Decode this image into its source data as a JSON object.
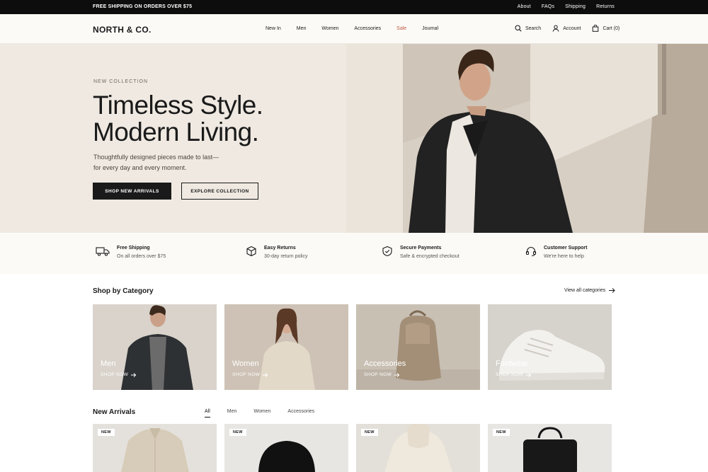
{
  "topbar": {
    "promo": "FREE SHIPPING ON ORDERS OVER $75",
    "links": [
      "About",
      "FAQs",
      "Shipping",
      "Returns"
    ]
  },
  "nav": {
    "logo": "NORTH & CO.",
    "menu": [
      "New In",
      "Men",
      "Women",
      "Accessories",
      "Sale",
      "Journal"
    ],
    "search": "Search",
    "account": "Account",
    "cart": "Cart (0)"
  },
  "hero": {
    "eyebrow": "NEW COLLECTION",
    "headline_1": "Timeless Style.",
    "headline_2": "Modern Living.",
    "sub_1": "Thoughtfully designed pieces made to last—",
    "sub_2": "for every day and every moment.",
    "cta_primary": "SHOP NEW ARRIVALS",
    "cta_secondary": "EXPLORE COLLECTION"
  },
  "features": [
    {
      "title": "Free Shipping",
      "sub": "On all orders over $75",
      "icon": "truck-icon"
    },
    {
      "title": "Easy Returns",
      "sub": "30-day return policy",
      "icon": "box-icon"
    },
    {
      "title": "Secure Payments",
      "sub": "Safe & encrypted checkout",
      "icon": "shield-icon"
    },
    {
      "title": "Customer Support",
      "sub": "We're here to help",
      "icon": "headset-icon"
    }
  ],
  "categories": {
    "title": "Shop by Category",
    "view_all": "View all categories",
    "shop_now": "SHOP NOW",
    "items": [
      "Men",
      "Women",
      "Accessories",
      "Footwear"
    ]
  },
  "arrivals": {
    "title": "New Arrivals",
    "tabs": [
      "All",
      "Men",
      "Women",
      "Accessories"
    ],
    "badge": "NEW"
  },
  "colors": {
    "sale": "#c25a44",
    "dark": "#1a1a1a",
    "hero_bg": "#efe9e1"
  }
}
